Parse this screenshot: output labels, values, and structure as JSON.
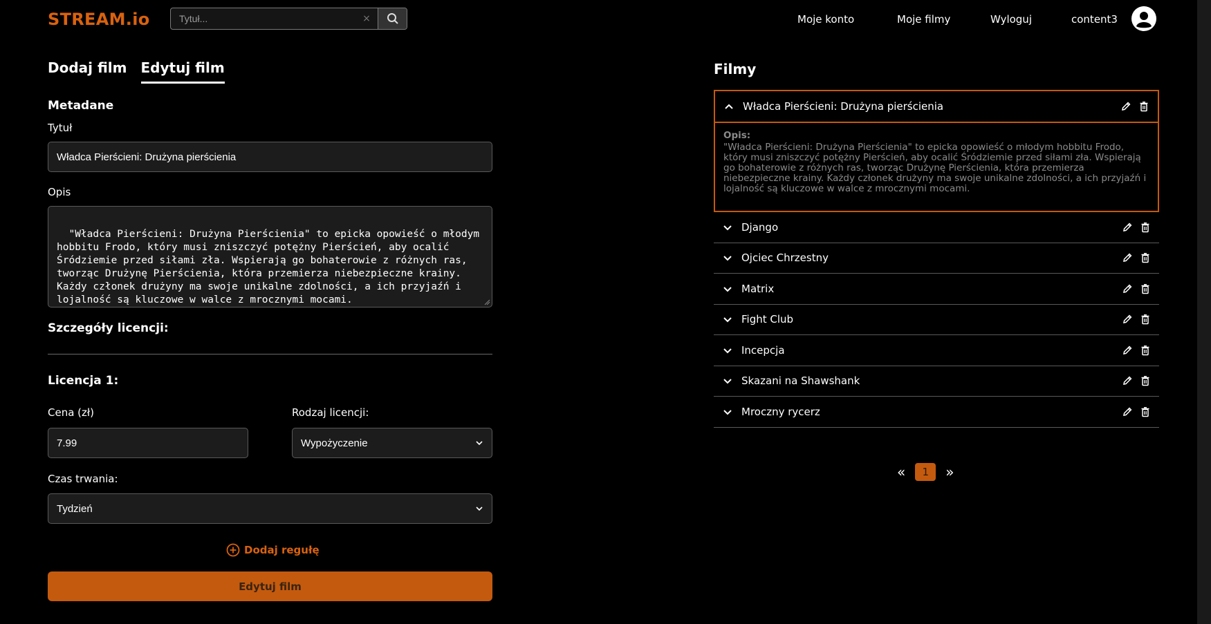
{
  "header": {
    "logo": "STREAM.io",
    "search_placeholder": "Tytuł...",
    "search_clear": "×",
    "nav": [
      "Moje konto",
      "Moje filmy",
      "Wyloguj",
      "content3"
    ]
  },
  "form": {
    "tabs": [
      "Dodaj film",
      "Edytuj film"
    ],
    "active_tab": "Edytuj film",
    "metadata_title": "Metadane",
    "title_label": "Tytuł",
    "title_value": "Władca Pierścieni: Drużyna pierścienia",
    "description_label": "Opis",
    "description_value": "\"Władca Pierścieni: Drużyna Pierścienia\" to epicka opowieść o młodym hobbitu Frodo, który musi zniszczyć potężny Pierścień, aby ocalić Śródziemie przed siłami zła. Wspierają go bohaterowie z różnych ras, tworząc Drużynę Pierścienia, która przemierza niebezpieczne krainy. Każdy członek drużyny ma swoje unikalne zdolności, a ich przyjaźń i lojalność są kluczowe w walce z mrocznymi mocami.",
    "license_details_title": "Szczegóły licencji:",
    "license_title": "Licencja 1:",
    "price_label": "Cena (zł)",
    "price_value": "7.99",
    "license_type_label": "Rodzaj licencji:",
    "license_type_value": "Wypożyczenie",
    "duration_label": "Czas trwania:",
    "duration_value": "Tydzień",
    "add_rule_label": "Dodaj regułę",
    "submit_label": "Edytuj film"
  },
  "films": {
    "title": "Filmy",
    "expanded": {
      "title": "Władca Pierścieni: Drużyna pierścienia",
      "description_label": "Opis:",
      "description": "\"Władca Pierścieni: Drużyna Pierścienia\" to epicka opowieść o młodym hobbitu Frodo, który musi zniszczyć potężny Pierścień, aby ocalić Śródziemie przed siłami zła. Wspierają go bohaterowie z różnych ras, tworząc Drużynę Pierścienia, która przemierza niebezpieczne krainy. Każdy członek drużyny ma swoje unikalne zdolności, a ich przyjaźń i lojalność są kluczowe w walce z mrocznymi mocami."
    },
    "items": [
      "Django",
      "Ojciec Chrzestny",
      "Matrix",
      "Fight Club",
      "Incepcja",
      "Skazani na Shawshank",
      "Mroczny rycerz"
    ]
  },
  "pagination": {
    "prev": "«",
    "current": "1",
    "next": "»"
  },
  "colors": {
    "accent": "#c45a0e",
    "logo": "#d9620f",
    "background": "#000000"
  }
}
